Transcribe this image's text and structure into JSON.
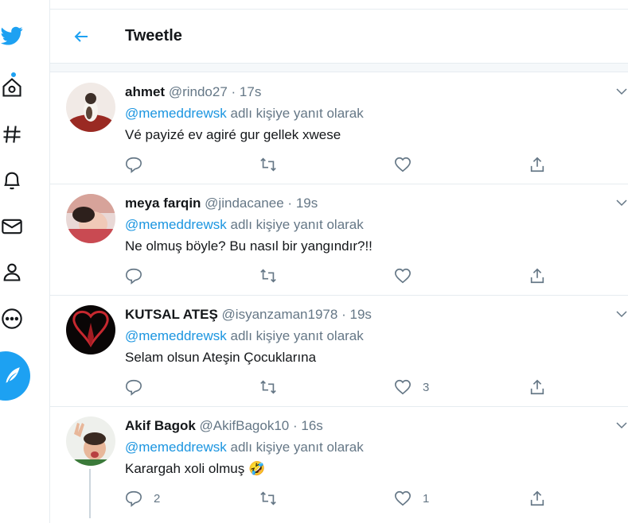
{
  "colors": {
    "accent": "#1da1f2",
    "secondary_text": "#657786",
    "border": "#e6ecf0"
  },
  "sidebar": {
    "items": [
      {
        "icon": "twitter-logo-icon"
      },
      {
        "icon": "home-icon"
      },
      {
        "icon": "hashtag-icon"
      },
      {
        "icon": "bell-icon"
      },
      {
        "icon": "mail-icon"
      },
      {
        "icon": "profile-icon"
      },
      {
        "icon": "more-icon"
      },
      {
        "icon": "compose-icon"
      }
    ]
  },
  "header": {
    "title": "Tweetle",
    "back_icon": "arrow-left-icon"
  },
  "tweets": [
    {
      "name": "ahmet",
      "handle": "@rindo27",
      "separator": "·",
      "time": "17s",
      "mention": "@memeddrewsk",
      "reply_suffix": " adlı kişiye yanıt olarak",
      "text": "Vé payizé ev agiré gur gellek xwese",
      "replies": "",
      "retweets": "",
      "likes": ""
    },
    {
      "name": "meya farqin",
      "handle": "@jindacanee",
      "separator": "·",
      "time": "19s",
      "mention": "@memeddrewsk",
      "reply_suffix": " adlı kişiye yanıt olarak",
      "text": "Ne olmuş böyle? Bu nasıl bir yangındır?!!",
      "replies": "",
      "retweets": "",
      "likes": ""
    },
    {
      "name": "KUTSAL ATEŞ",
      "handle": "@isyanzaman1978",
      "separator": "·",
      "time": "19s",
      "mention": "@memeddrewsk",
      "reply_suffix": " adlı kişiye yanıt olarak",
      "text": "Selam olsun Ateşin Çocuklarına",
      "replies": "",
      "retweets": "",
      "likes": "3"
    },
    {
      "name": "Akif Bagok",
      "handle": "@AkifBagok10",
      "separator": "·",
      "time": "16s",
      "mention": "@memeddrewsk",
      "reply_suffix": " adlı kişiye yanıt olarak",
      "text": "Karargah xoli olmuş 🤣",
      "replies": "2",
      "retweets": "",
      "likes": "1"
    }
  ]
}
